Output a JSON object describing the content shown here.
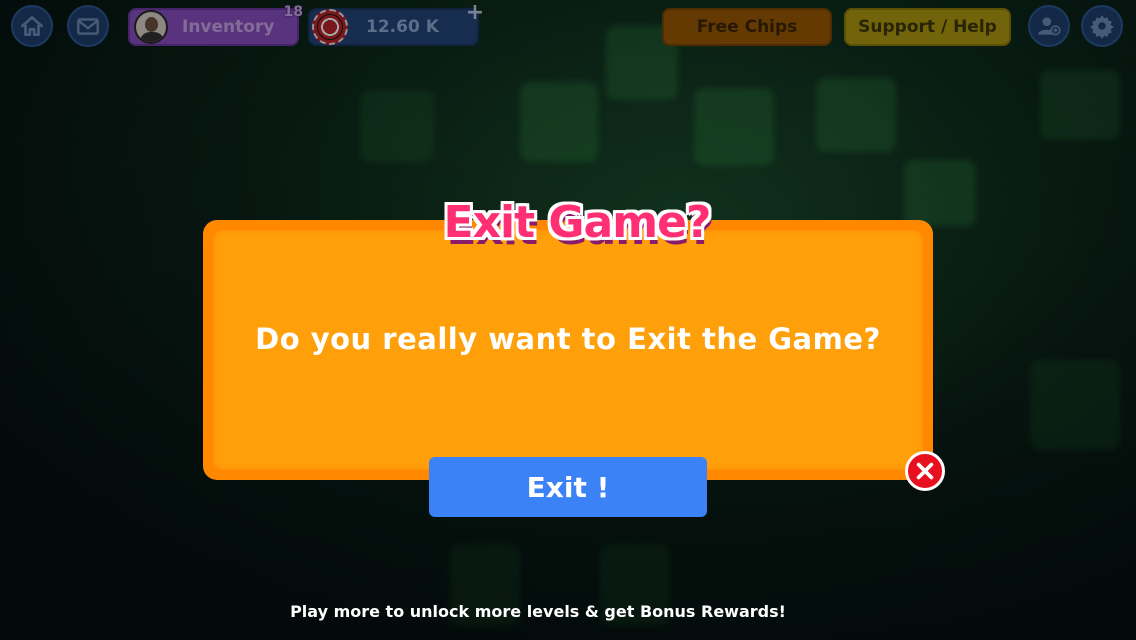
{
  "topbar": {
    "inventory": {
      "label": "Inventory",
      "badge": "18"
    },
    "chips": {
      "amount": "12.60 K",
      "plus": "+"
    },
    "free_chips_label": "Free Chips",
    "support_label": "Support / Help",
    "icons": [
      "home-icon",
      "mail-icon",
      "add-friend-icon",
      "gear-icon"
    ]
  },
  "dialog": {
    "title": "Exit Game?",
    "message": "Do you really want to Exit the Game?",
    "exit_label": "Exit !"
  },
  "footer": {
    "text": "Play more to unlock more levels & get Bonus Rewards!"
  },
  "colors": {
    "dialog_bg": "#ff9f0a",
    "title_pink": "#ff2f73",
    "exit_blue": "#3a82f5",
    "close_red": "#e8101e"
  }
}
